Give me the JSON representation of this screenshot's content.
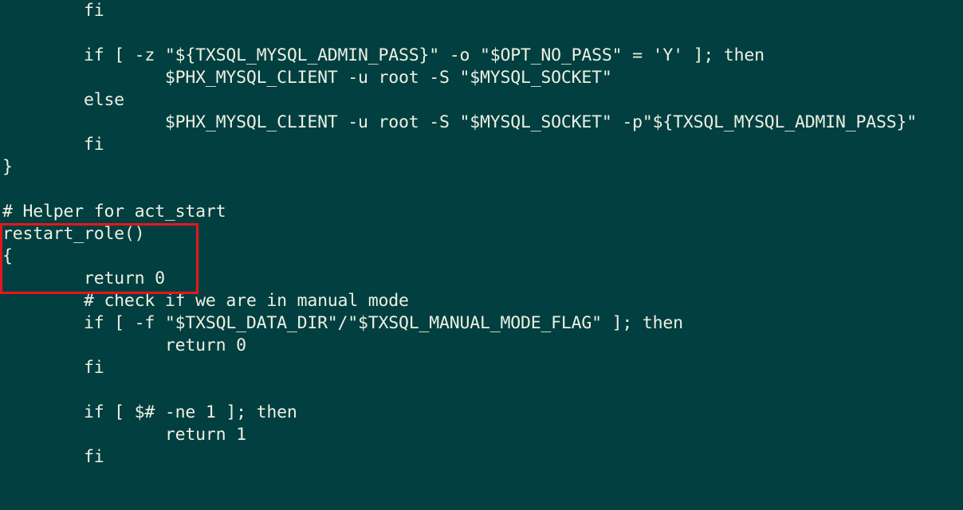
{
  "terminal": {
    "lines": [
      "        fi",
      "",
      "        if [ -z \"${TXSQL_MYSQL_ADMIN_PASS}\" -o \"$OPT_NO_PASS\" = 'Y' ]; then",
      "                $PHX_MYSQL_CLIENT -u root -S \"$MYSQL_SOCKET\"",
      "        else",
      "                $PHX_MYSQL_CLIENT -u root -S \"$MYSQL_SOCKET\" -p\"${TXSQL_MYSQL_ADMIN_PASS}\"",
      "        fi",
      "}",
      "",
      "# Helper for act_start",
      "restart_role()",
      "{",
      "        return 0",
      "        # check if we are in manual mode",
      "        if [ -f \"$TXSQL_DATA_DIR\"/\"$TXSQL_MANUAL_MODE_FLAG\" ]; then",
      "                return 0",
      "        fi",
      "",
      "        if [ $# -ne 1 ]; then",
      "                return 1",
      "        fi"
    ],
    "highlight": {
      "description": "restart_role() function header with early return",
      "color": "#e8161b"
    },
    "colors": {
      "background": "#013f40",
      "text": "#eef0e2"
    }
  }
}
